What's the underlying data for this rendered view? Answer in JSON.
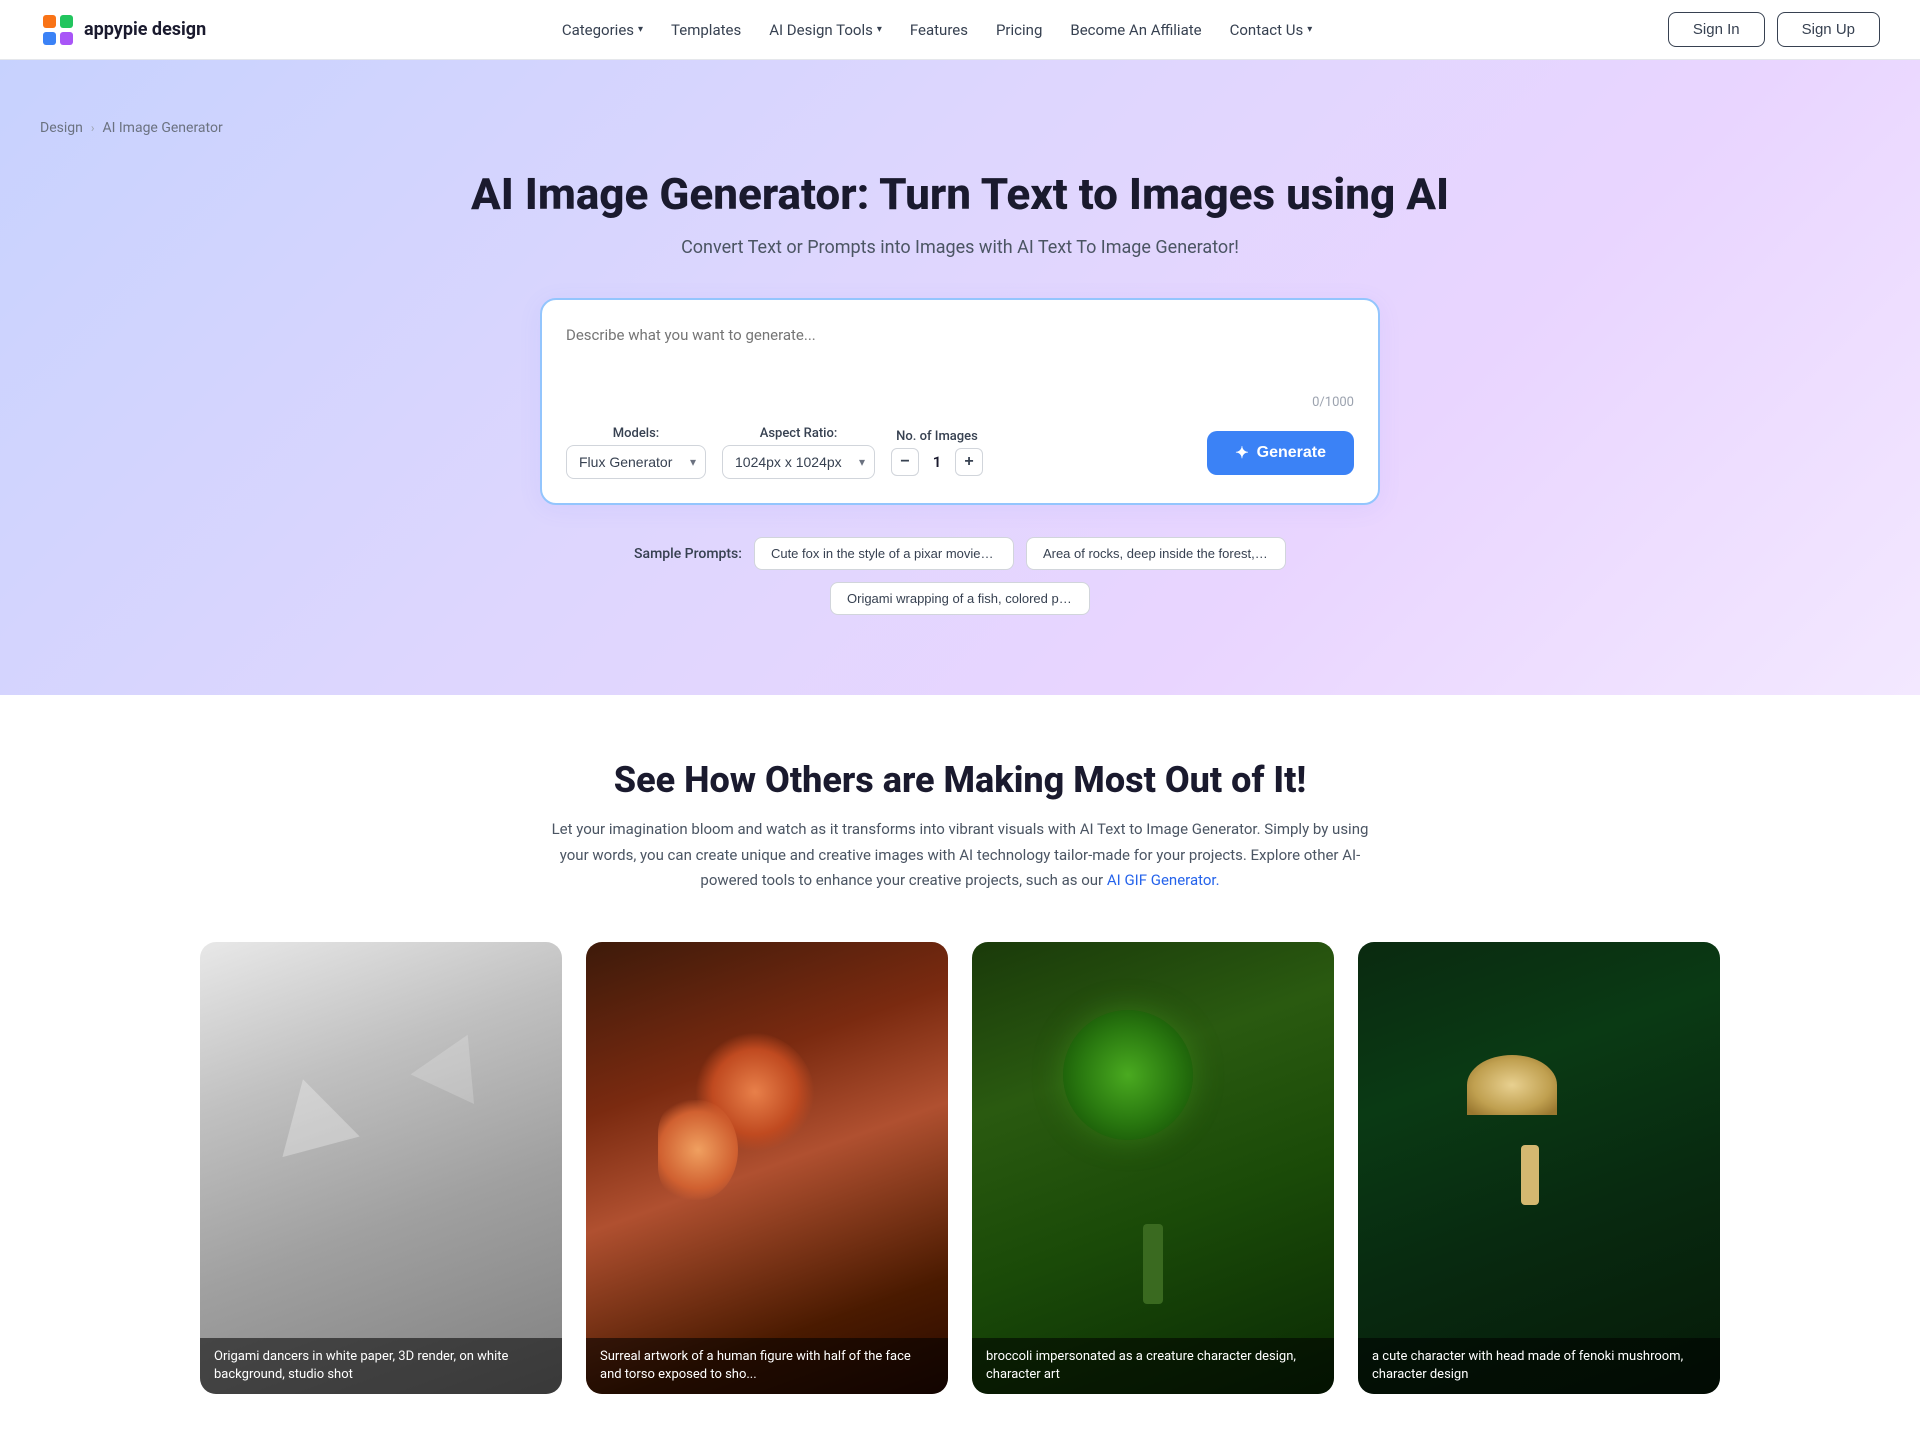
{
  "brand": {
    "name": "appypie design",
    "logo_alt": "Appypie Design Logo"
  },
  "nav": {
    "links": [
      {
        "id": "categories",
        "label": "Categories",
        "has_dropdown": true
      },
      {
        "id": "templates",
        "label": "Templates",
        "has_dropdown": false
      },
      {
        "id": "ai-design-tools",
        "label": "AI Design Tools",
        "has_dropdown": true
      },
      {
        "id": "features",
        "label": "Features",
        "has_dropdown": false
      },
      {
        "id": "pricing",
        "label": "Pricing",
        "has_dropdown": false
      },
      {
        "id": "affiliate",
        "label": "Become An Affiliate",
        "has_dropdown": false
      },
      {
        "id": "contact",
        "label": "Contact Us",
        "has_dropdown": true
      }
    ],
    "sign_in": "Sign In",
    "sign_up": "Sign Up"
  },
  "breadcrumb": {
    "items": [
      {
        "label": "Design",
        "href": "#"
      },
      {
        "label": "AI Image Generator"
      }
    ]
  },
  "hero": {
    "title": "AI Image Generator: Turn Text to Images using AI",
    "subtitle": "Convert Text or Prompts into Images with AI Text To Image Generator!"
  },
  "generator": {
    "textarea_placeholder": "Describe what you want to generate...",
    "char_count": "0/1000",
    "models_label": "Models:",
    "models_value": "Flux Generator",
    "aspect_ratio_label": "Aspect Ratio:",
    "aspect_ratio_value": "1024px x 1024px",
    "images_label": "No. of Images",
    "images_count": 1,
    "minus_label": "−",
    "plus_label": "+",
    "generate_label": "Generate",
    "generate_icon": "✦"
  },
  "sample_prompts": {
    "label": "Sample Prompts:",
    "items": [
      {
        "id": "prompt1",
        "label": "Cute fox in the style of a pixar movie wears a h..."
      },
      {
        "id": "prompt2",
        "label": "Area of rocks, deep inside the forest, divine do..."
      },
      {
        "id": "prompt3",
        "label": "Origami wrapping of a fish, colored paper on to..."
      }
    ]
  },
  "gallery": {
    "title": "See How Others are Making Most Out of It!",
    "description": "Let your imagination bloom and watch as it transforms into vibrant visuals with AI Text to Image Generator. Simply by using your words, you can create unique and creative images with AI technology tailor-made for your projects. Explore other AI-powered tools to enhance your creative projects, such as our",
    "link_text": "AI GIF Generator.",
    "link_href": "#",
    "items": [
      {
        "id": "img1",
        "style": "origami",
        "caption": "Origami dancers in white paper, 3D render, on white background, studio shot"
      },
      {
        "id": "img2",
        "style": "surreal",
        "caption": "Surreal artwork of a human figure with half of the face and torso exposed to sho..."
      },
      {
        "id": "img3",
        "style": "broccoli",
        "caption": "broccoli impersonated as a creature character design, character art"
      },
      {
        "id": "img4",
        "style": "mushroom",
        "caption": "a cute character with head made of fenoki mushroom, character design"
      }
    ]
  }
}
